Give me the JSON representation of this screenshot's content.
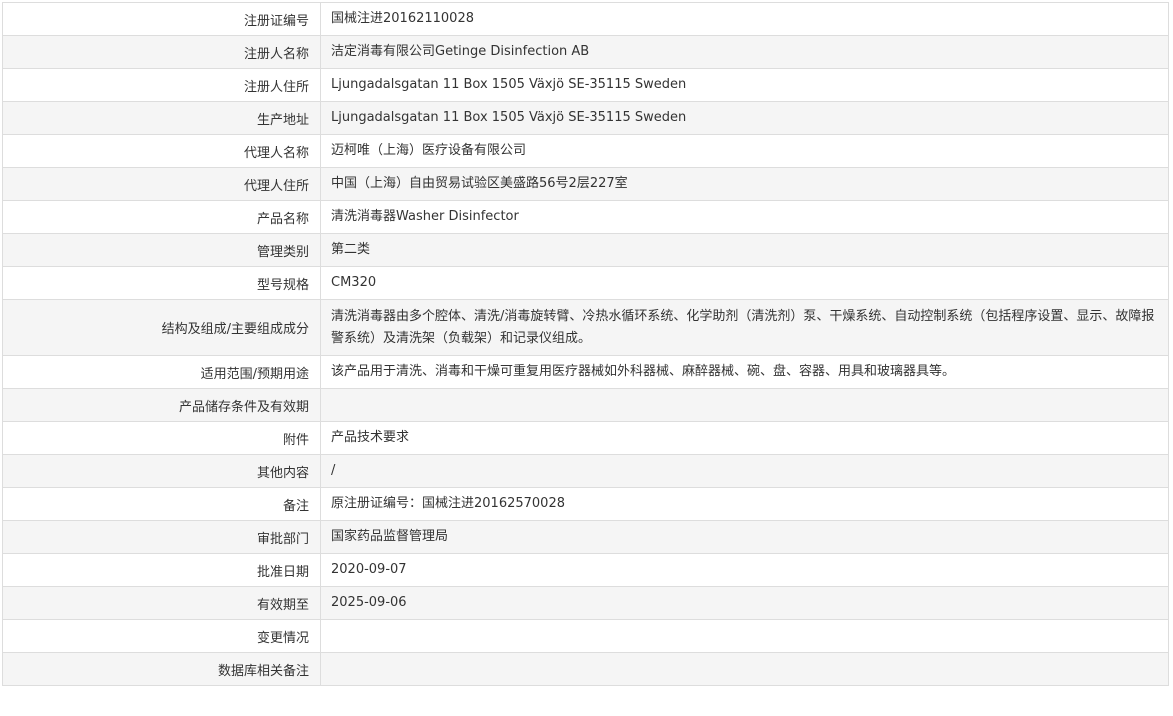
{
  "record": {
    "rows": [
      {
        "label": "注册证编号",
        "value": "国械注进20162110028"
      },
      {
        "label": "注册人名称",
        "value": "洁定消毒有限公司Getinge Disinfection AB"
      },
      {
        "label": "注册人住所",
        "value": "Ljungadalsgatan 11 Box 1505 Växjö SE-35115 Sweden"
      },
      {
        "label": "生产地址",
        "value": "Ljungadalsgatan 11 Box 1505 Växjö SE-35115 Sweden"
      },
      {
        "label": "代理人名称",
        "value": "迈柯唯（上海）医疗设备有限公司"
      },
      {
        "label": "代理人住所",
        "value": "中国（上海）自由贸易试验区美盛路56号2层227室"
      },
      {
        "label": "产品名称",
        "value": "清洗消毒器Washer Disinfector"
      },
      {
        "label": "管理类别",
        "value": "第二类"
      },
      {
        "label": "型号规格",
        "value": "CM320"
      },
      {
        "label": "结构及组成/主要组成成分",
        "value": "清洗消毒器由多个腔体、清洗/消毒旋转臂、冷热水循环系统、化学助剂（清洗剂）泵、干燥系统、自动控制系统（包括程序设置、显示、故障报警系统）及清洗架（负载架）和记录仪组成。"
      },
      {
        "label": "适用范围/预期用途",
        "value": "该产品用于清洗、消毒和干燥可重复用医疗器械如外科器械、麻醉器械、碗、盘、容器、用具和玻璃器具等。"
      },
      {
        "label": "产品储存条件及有效期",
        "value": ""
      },
      {
        "label": "附件",
        "value": "产品技术要求"
      },
      {
        "label": "其他内容",
        "value": "/"
      },
      {
        "label": "备注",
        "value": "原注册证编号：国械注进20162570028"
      },
      {
        "label": "审批部门",
        "value": "国家药品监督管理局"
      },
      {
        "label": "批准日期",
        "value": "2020-09-07"
      },
      {
        "label": "有效期至",
        "value": "2025-09-06"
      },
      {
        "label": "变更情况",
        "value": ""
      },
      {
        "label": "数据库相关备注",
        "value": ""
      }
    ]
  },
  "colors": {
    "border": "#dddddd",
    "row_shaded": "#f5f5f5",
    "row_plain": "#ffffff",
    "text": "#333333"
  }
}
